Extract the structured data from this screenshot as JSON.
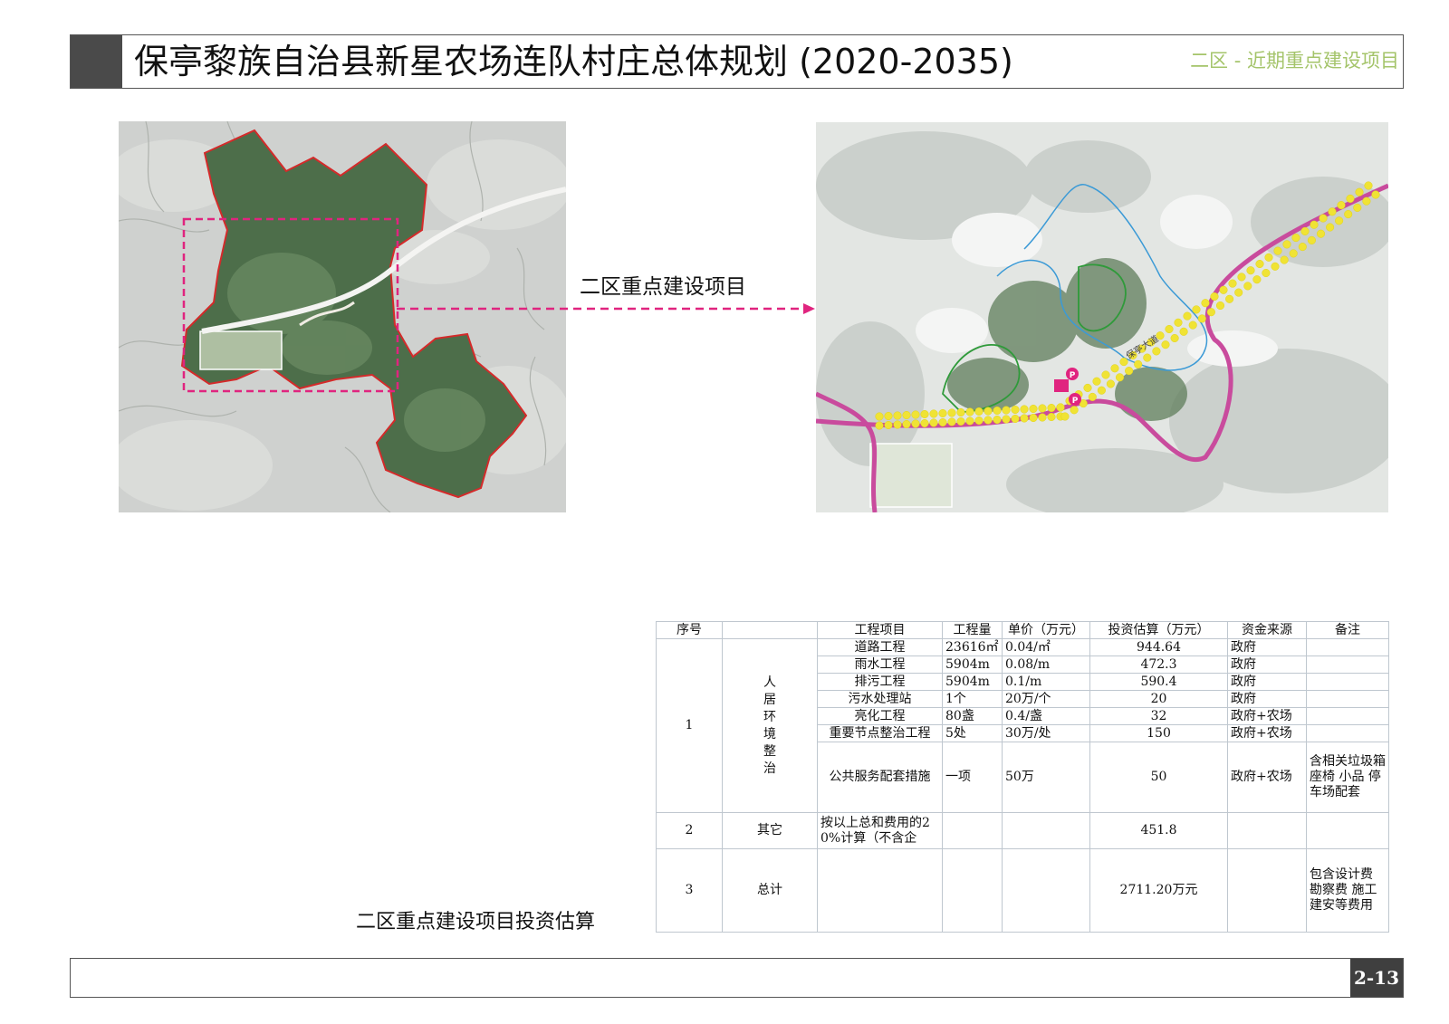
{
  "header": {
    "title": "保亭黎族自治县新星农场连队村庄总体规划 (2020-2035)",
    "subtitle": "二区 - 近期重点建设项目"
  },
  "callout": {
    "label": "二区重点建设项目"
  },
  "right_map": {
    "road_label": "保亭大道"
  },
  "table": {
    "caption": "二区重点建设项目投资估算",
    "headers": [
      "序号",
      "",
      "工程项目",
      "工程量",
      "单价（万元）",
      "投资估算（万元）",
      "资金来源",
      "备注"
    ],
    "group1": {
      "no": "1",
      "category": "人居环境整治",
      "rows": [
        {
          "item": "道路工程",
          "qty": "23616㎡",
          "price": "0.04/㎡",
          "invest": "944.64",
          "source": "政府",
          "note": ""
        },
        {
          "item": "雨水工程",
          "qty": "5904m",
          "price": "0.08/m",
          "invest": "472.3",
          "source": "政府",
          "note": ""
        },
        {
          "item": "排污工程",
          "qty": "5904m",
          "price": "0.1/m",
          "invest": "590.4",
          "source": "政府",
          "note": ""
        },
        {
          "item": "污水处理站",
          "qty": "1个",
          "price": "20万/个",
          "invest": "20",
          "source": "政府",
          "note": ""
        },
        {
          "item": "亮化工程",
          "qty": "80盏",
          "price": "0.4/盏",
          "invest": "32",
          "source": "政府+农场",
          "note": ""
        },
        {
          "item": "重要节点整治工程",
          "qty": "5处",
          "price": "30万/处",
          "invest": "150",
          "source": "政府+农场",
          "note": ""
        },
        {
          "item": "公共服务配套措施",
          "qty": "一项",
          "price": "50万",
          "invest": "50",
          "source": "政府+农场",
          "note": "含相关垃圾箱 座椅 小品 停车场配套"
        }
      ]
    },
    "row2": {
      "no": "2",
      "category": "其它",
      "item": "按以上总和费用的20%计算（不含企",
      "invest": "451.8"
    },
    "row3": {
      "no": "3",
      "category": "总计",
      "invest": "2711.20万元",
      "note": "包含设计费 勘察费 施工建安等费用"
    }
  },
  "footer": {
    "page": "2-13"
  },
  "colors": {
    "accent_green": "#a4c46a",
    "callout_magenta": "#e0247f",
    "boundary_red": "#d42a2a",
    "forest_green": "#4d6e4a",
    "road_pink": "#c94b9d",
    "node_yellow": "#f0e334",
    "path_blue": "#3b9ad6"
  }
}
